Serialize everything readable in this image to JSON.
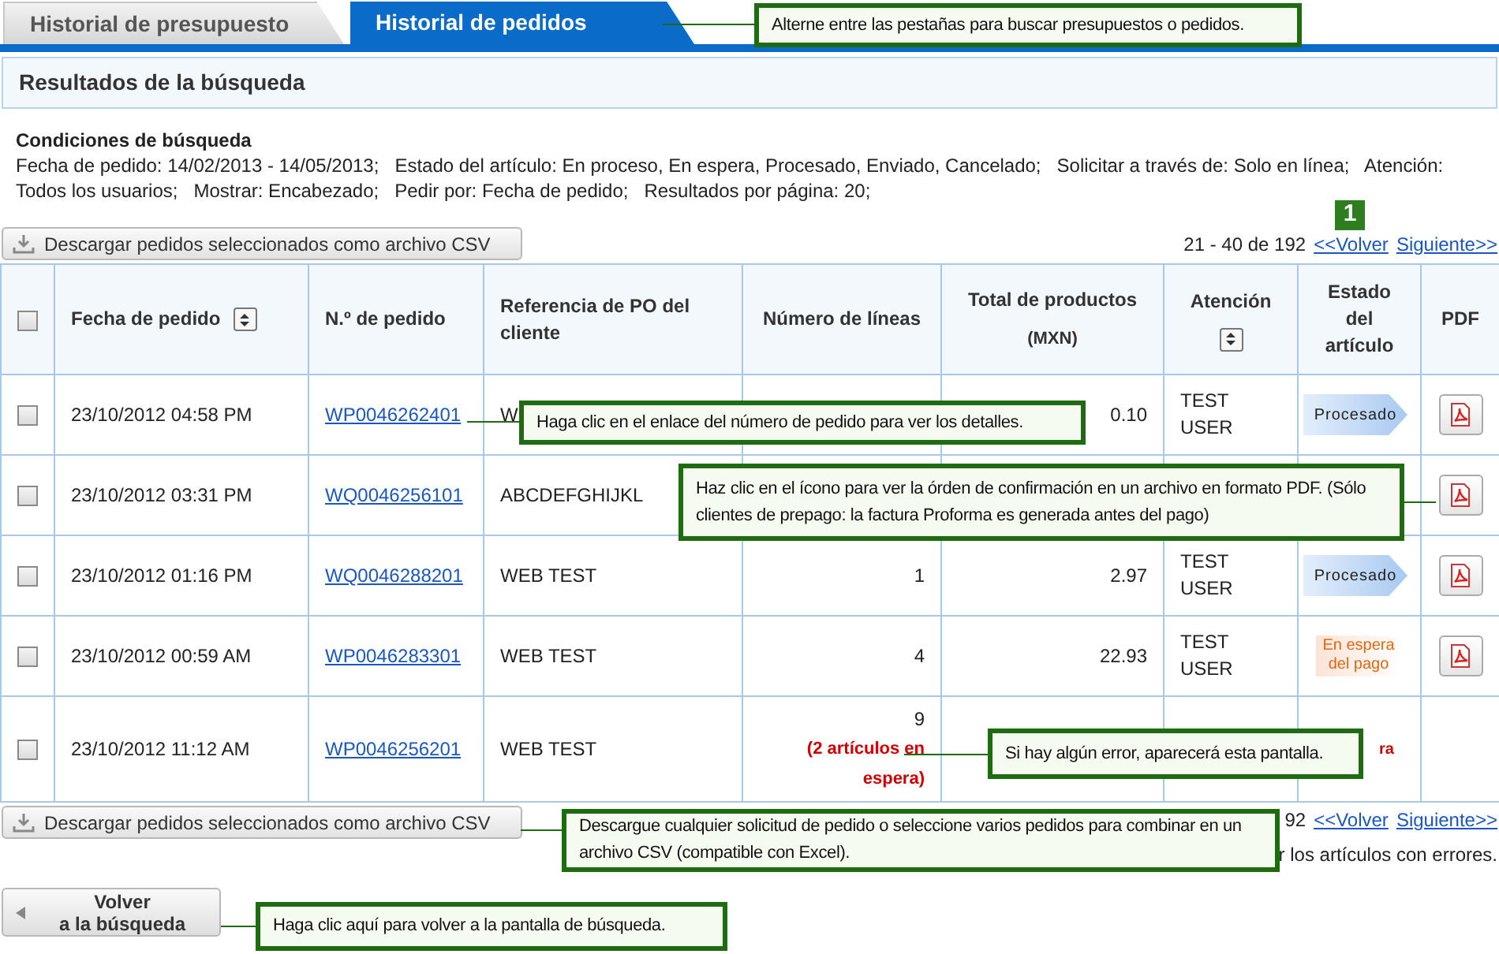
{
  "tabs": [
    {
      "label": "Historial de presupuesto",
      "selected": false
    },
    {
      "label": "Historial de pedidos",
      "selected": true
    }
  ],
  "results_title": "Resultados de la búsqueda",
  "conditions": {
    "title": "Condiciones de búsqueda",
    "text": "Fecha de pedido: 14/02/2013 - 14/05/2013;   Estado del artículo: En proceso, En espera, Procesado, Enviado, Cancelado;   Solicitar a través de: Solo en línea;   Atención: Todos los usuarios;   Mostrar: Encabezado;   Pedir por: Fecha de pedido;   Resultados por página: 20;"
  },
  "csv_button_top": "Descargar pedidos seleccionados como archivo CSV",
  "pagination_top": {
    "range": "21 - 40 de 192",
    "prev": "<<Volver",
    "next": "Siguiente>>"
  },
  "badge": "1",
  "header_checkbox": {
    "checked": false
  },
  "columns": [
    {
      "label": "Fecha de pedido",
      "sortable": true
    },
    {
      "label": "N.º de pedido",
      "sortable": false
    },
    {
      "label": "Referencia de PO del cliente",
      "sortable": false
    },
    {
      "label": "Número de líneas",
      "sortable": false
    },
    {
      "label": "Total de productos",
      "sub": "(MXN)",
      "sortable": false
    },
    {
      "label": "Atención",
      "sortable": true
    },
    {
      "label": "Estado del artículo",
      "sortable": false
    },
    {
      "label": "PDF",
      "sortable": false
    }
  ],
  "rows": [
    {
      "checked": false,
      "date": "23/10/2012 04:58 PM",
      "order": "WP0046262401",
      "reference": "W",
      "total": "0.10",
      "attention": "TEST USER",
      "status": {
        "kind": "processed",
        "label": "Procesado"
      },
      "pdf": true
    },
    {
      "checked": false,
      "date": "23/10/2012 03:31 PM",
      "order": "WQ0046256101",
      "reference": "ABCDEFGHIJKL",
      "pdf": true
    },
    {
      "checked": false,
      "date": "23/10/2012 01:16 PM",
      "order": "WQ0046288201",
      "reference": "WEB TEST",
      "lines": "1",
      "total": "2.97",
      "attention": "TEST USER",
      "status": {
        "kind": "processed",
        "label": "Procesado"
      },
      "pdf": true
    },
    {
      "checked": false,
      "date": "23/10/2012 00:59 AM",
      "order": "WP0046283301",
      "reference": "WEB TEST",
      "lines": "4",
      "total": "22.93",
      "attention": "TEST USER",
      "status": {
        "kind": "on_hold",
        "label": "En espera del pago"
      },
      "pdf": true
    },
    {
      "checked": false,
      "date": "23/10/2012 11:12 AM",
      "order": "WP0046256201",
      "reference": "WEB TEST",
      "lines": "9",
      "lines_note": "(2 artículos en espera)",
      "status": {
        "kind": "error",
        "label": "ra"
      },
      "pdf": false
    }
  ],
  "csv_button_bottom": "Descargar pedidos seleccionados como archivo CSV",
  "pagination_bottom": {
    "range": "92",
    "prev": "<<Volver",
    "next": "Siguiente>>"
  },
  "bottom_note": "r los artículos con errores.",
  "back_button": [
    "Volver",
    "a la búsqueda"
  ],
  "callouts": [
    {
      "text": "Alterne entre las pestañas para buscar presupuestos o pedidos."
    },
    {
      "text": "Haga clic en el enlace del número de pedido para ver los detalles."
    },
    {
      "text": "Haz clic en el ícono para ver la órden de confirmación en un archivo en formato PDF. (Sólo clientes de prepago: la factura Proforma es generada antes del pago)"
    },
    {
      "text": "Si hay algún error, aparecerá esta pantalla."
    },
    {
      "text": "Descargue cualquier solicitud de pedido o seleccione varios pedidos para combinar en un archivo CSV (compatible con Excel)."
    },
    {
      "text": "Haga clic aquí para volver a la pantalla de búsqueda."
    }
  ]
}
